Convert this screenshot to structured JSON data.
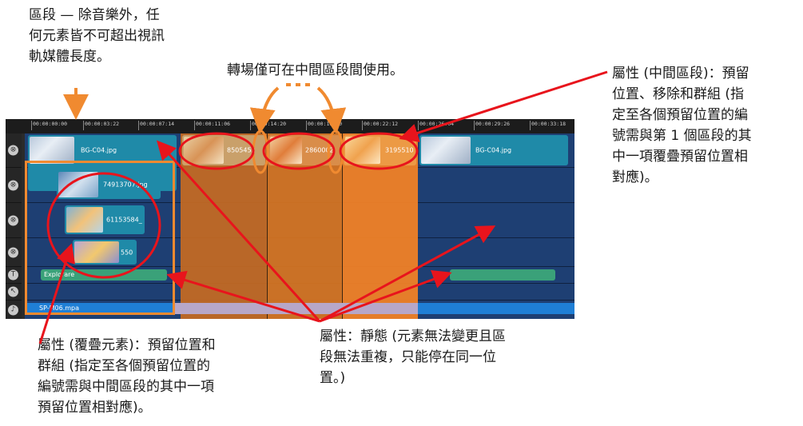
{
  "annotations": {
    "section_rule": "區段 — 除音樂外，任\n何元素皆不可超出視訊\n軌媒體長度。",
    "transition_rule": "轉場僅可在中間區段間使用。",
    "middle_section": "屬性 (中間區段)：預留\n位置、移除和群組 (指\n定至各個預留位置的編\n號需與第 1 個區段的其\n中一項覆疊預留位置相\n對應)。",
    "overlay_element": "屬性 (覆疊元素)：預留位置和\n群組 (指定至各個預留位置的\n編號需與中間區段的其中一項\n預留位置相對應)。",
    "static": "屬性：靜態 (元素無法變更且區\n段無法重複，只能停在同一位\n置。)"
  },
  "timeline": {
    "ruler_ticks": [
      "00:00:00:00",
      "00:00:03:22",
      "00:00:07:14",
      "00:00:11:06",
      "00:00:14:20",
      "00:00:18:20",
      "00:00:22:12",
      "00:00:26:04",
      "00:00:29:26",
      "00:00:33:18"
    ],
    "clips": {
      "video_start": "BG-C04.jpg",
      "video_end": "BG-C04.jpg",
      "middle_1": "8505452",
      "middle_2": "2860002",
      "middle_3": "3195510",
      "overlay_1": "74913707.jpg",
      "overlay_2": "61153584_",
      "overlay_3": "550",
      "title_1": "Explorare",
      "title_2": "",
      "audio": "SP-M06.mpa"
    }
  },
  "colors": {
    "start_frame": "#f08a30",
    "middle_section": "#f07a1a",
    "arrow_red": "#e8141c",
    "clip_blue": "#1f8aa8",
    "lane_blue": "#1e3f73",
    "title_green": "#3aa179",
    "audio_blue": "#1f7fd6"
  }
}
